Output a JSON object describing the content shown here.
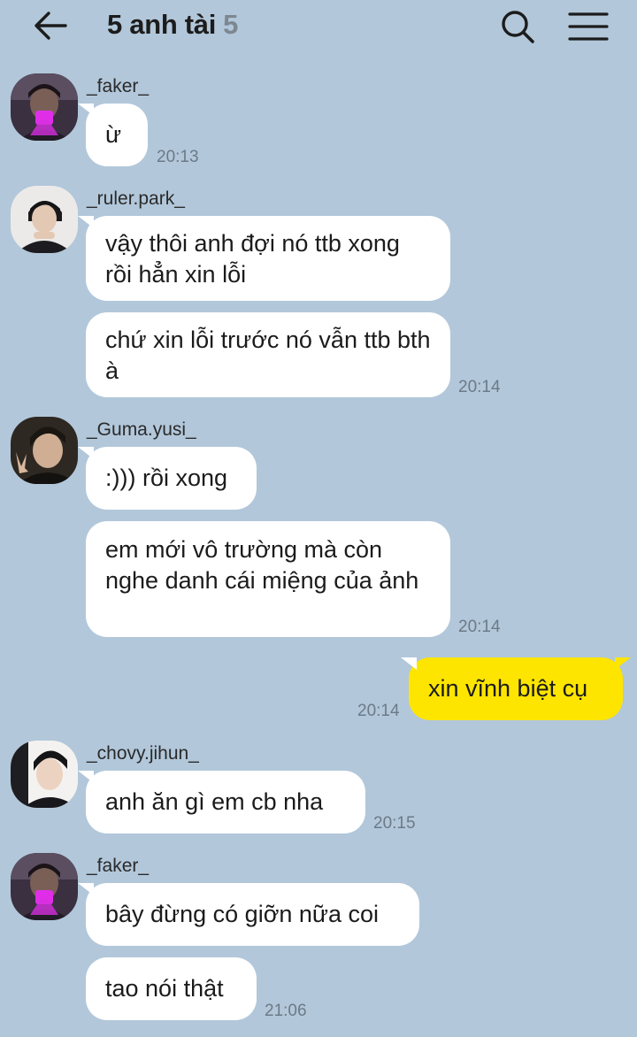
{
  "header": {
    "title": "5 anh tài",
    "member_count": "5",
    "back_icon": "arrow-left-icon",
    "search_icon": "search-icon",
    "menu_icon": "hamburger-menu-icon"
  },
  "colors": {
    "background": "#b2c7da",
    "incoming_bubble": "#ffffff",
    "outgoing_bubble": "#fee500",
    "time_text": "#6c7a87"
  },
  "messages": [
    {
      "sender": "_faker_",
      "texts": [
        "ừ"
      ],
      "time": "20:13"
    },
    {
      "sender": "_ruler.park_",
      "texts": [
        "vậy thôi anh đợi nó ttb xong rồi hẳn xin lỗi",
        "chứ xin lỗi trước nó vẫn ttb bth à"
      ],
      "time": "20:14"
    },
    {
      "sender": "_Guma.yusi_",
      "texts": [
        ":))) rồi xong",
        "em mới vô trường mà còn nghe danh cái miệng của ảnh"
      ],
      "time": "20:14"
    },
    {
      "sender": "me",
      "texts": [
        "xin vĩnh biệt cụ"
      ],
      "time": "20:14"
    },
    {
      "sender": "_chovy.jihun_",
      "texts": [
        "anh ăn gì em cb nha"
      ],
      "time": "20:15"
    },
    {
      "sender": "_faker_",
      "texts": [
        "bây đừng có giỡn nữa coi",
        "tao nói thật"
      ],
      "time": "21:06"
    }
  ]
}
